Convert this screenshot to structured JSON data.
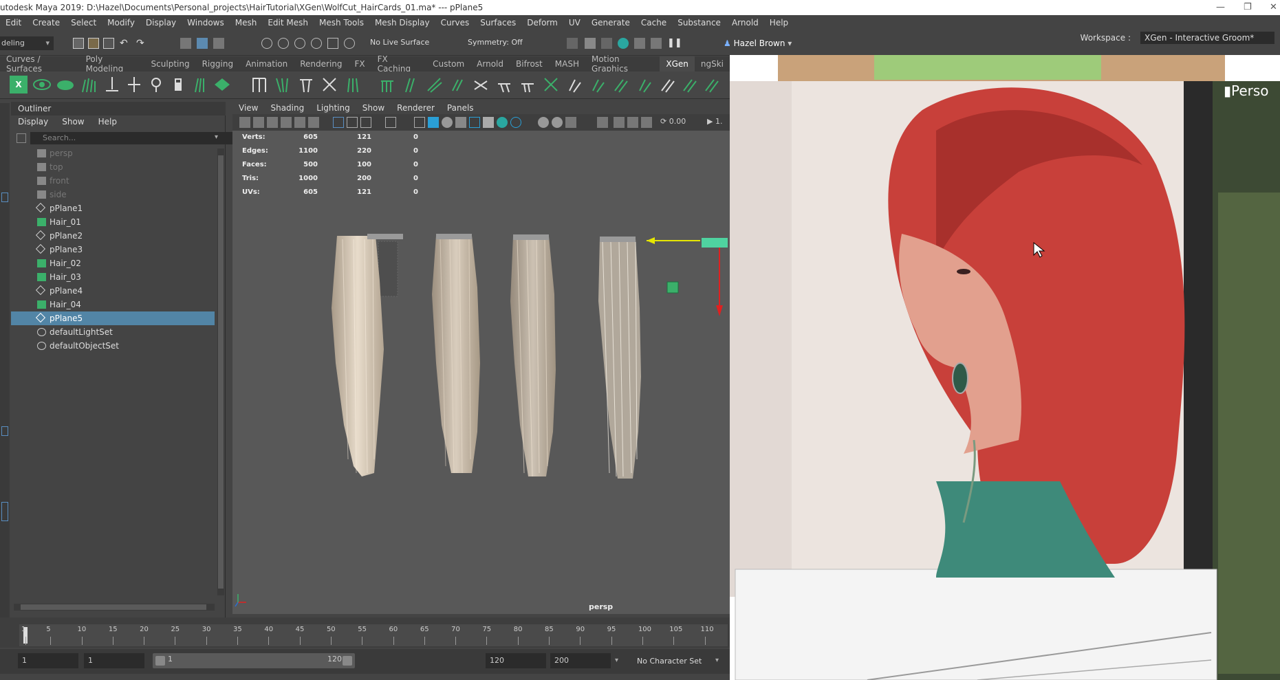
{
  "window": {
    "title": "utodesk Maya 2019: D:\\Hazel\\Documents\\Personal_projects\\HairTutorial\\XGen\\WolfCut_HairCards_01.ma*   ---   pPlane5"
  },
  "menubar": [
    "Edit",
    "Create",
    "Select",
    "Modify",
    "Display",
    "Windows",
    "Mesh",
    "Edit Mesh",
    "Mesh Tools",
    "Mesh Display",
    "Curves",
    "Surfaces",
    "Deform",
    "UV",
    "Generate",
    "Cache",
    "Substance",
    "Arnold",
    "Help"
  ],
  "workspace": {
    "label": "Workspace :",
    "value": "XGen - Interactive Groom*"
  },
  "statusline": {
    "mode": "deling",
    "live_surface": "No Live Surface",
    "symmetry": "Symmetry: Off",
    "user": "Hazel Brown"
  },
  "shelf_tabs": [
    "Curves / Surfaces",
    "Poly Modeling",
    "Sculpting",
    "Rigging",
    "Animation",
    "Rendering",
    "FX",
    "FX Caching",
    "Custom",
    "Arnold",
    "Bifrost",
    "MASH",
    "Motion Graphics",
    "XGen",
    "ngSki"
  ],
  "shelf_active": "XGen",
  "outliner": {
    "title": "Outliner",
    "menu": [
      "Display",
      "Show",
      "Help"
    ],
    "search_placeholder": "Search...",
    "items": [
      {
        "label": "persp",
        "type": "camera",
        "dim": true
      },
      {
        "label": "top",
        "type": "camera",
        "dim": true
      },
      {
        "label": "front",
        "type": "camera",
        "dim": true
      },
      {
        "label": "side",
        "type": "camera",
        "dim": true
      },
      {
        "label": "pPlane1",
        "type": "mesh"
      },
      {
        "label": "Hair_01",
        "type": "xgen"
      },
      {
        "label": "pPlane2",
        "type": "mesh"
      },
      {
        "label": "pPlane3",
        "type": "mesh"
      },
      {
        "label": "Hair_02",
        "type": "xgen"
      },
      {
        "label": "Hair_03",
        "type": "xgen"
      },
      {
        "label": "pPlane4",
        "type": "mesh"
      },
      {
        "label": "Hair_04",
        "type": "xgen"
      },
      {
        "label": "pPlane5",
        "type": "mesh",
        "selected": true
      },
      {
        "label": "defaultLightSet",
        "type": "set"
      },
      {
        "label": "defaultObjectSet",
        "type": "set"
      }
    ]
  },
  "viewport": {
    "menu": [
      "View",
      "Shading",
      "Lighting",
      "Show",
      "Renderer",
      "Panels"
    ],
    "field_value": "0.00",
    "field_value2": "1.",
    "camera_label": "persp",
    "hud": [
      {
        "label": "Verts:",
        "a": "605",
        "b": "121",
        "c": "0"
      },
      {
        "label": "Edges:",
        "a": "1100",
        "b": "220",
        "c": "0"
      },
      {
        "label": "Faces:",
        "a": "500",
        "b": "100",
        "c": "0"
      },
      {
        "label": "Tris:",
        "a": "1000",
        "b": "200",
        "c": "0"
      },
      {
        "label": "UVs:",
        "a": "605",
        "b": "121",
        "c": "0"
      }
    ]
  },
  "timeslider": {
    "ticks": [
      "1",
      "5",
      "10",
      "15",
      "20",
      "25",
      "30",
      "35",
      "40",
      "45",
      "50",
      "55",
      "60",
      "65",
      "70",
      "75",
      "80",
      "85",
      "90",
      "95",
      "100",
      "105",
      "110"
    ]
  },
  "range": {
    "start": "1",
    "playback_start": "1",
    "slider_start": "1",
    "slider_end": "120",
    "playback_end": "120",
    "end": "200",
    "character_set": "No Character Set"
  },
  "overlay_text": "Perso",
  "colors": {
    "selection": "#5285a6",
    "shelf_green": "#3bb06a",
    "hair": "#d9c7b0",
    "red_hair": "#c8403a"
  }
}
